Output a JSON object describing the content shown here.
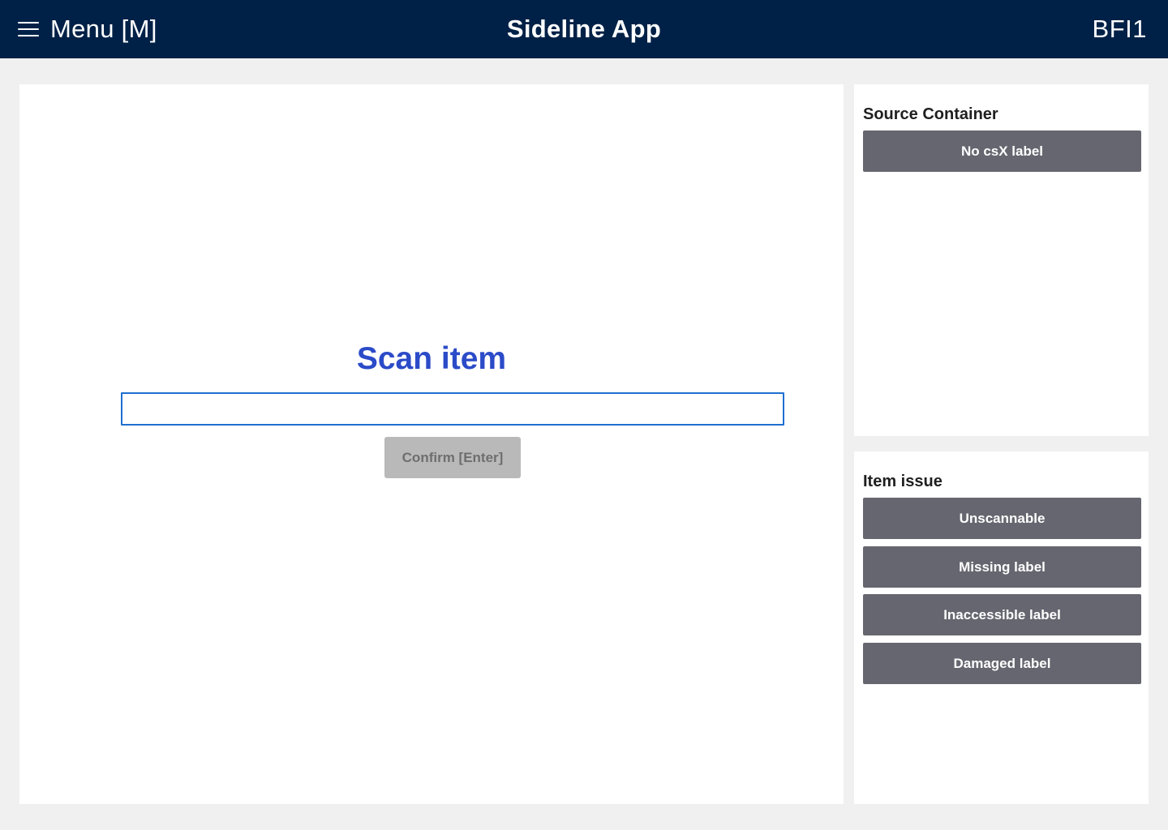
{
  "header": {
    "menu_label": "Menu [M]",
    "app_title": "Sideline App",
    "site_code": "BFI1",
    "background_color": "#002147"
  },
  "main": {
    "heading_regular": "Scan ",
    "heading_bold": "item",
    "scan_input_value": "",
    "confirm_label": "Confirm [Enter]",
    "heading_color": "#2b4bc8"
  },
  "source_container": {
    "title": "Source Container",
    "buttons": [
      "No csX label"
    ]
  },
  "item_issue": {
    "title": "Item issue",
    "buttons": [
      "Unscannable",
      "Missing label",
      "Inaccessible label",
      "Damaged label"
    ]
  },
  "colors": {
    "action_button": "#666670",
    "disabled_button": "#b9b9b9",
    "input_border": "#1e6fd0"
  }
}
